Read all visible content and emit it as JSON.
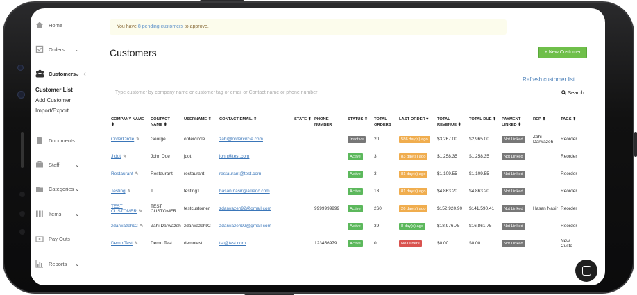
{
  "sidebar": {
    "items": [
      {
        "label": "Home",
        "icon": "home-icon"
      },
      {
        "label": "Orders",
        "icon": "orders-icon"
      },
      {
        "label": "Customers",
        "icon": "customers-icon"
      },
      {
        "label": "Documents",
        "icon": "documents-icon"
      },
      {
        "label": "Staff",
        "icon": "staff-icon"
      },
      {
        "label": "Categories",
        "icon": "categories-icon"
      },
      {
        "label": "Items",
        "icon": "items-icon"
      },
      {
        "label": "Pay Outs",
        "icon": "payouts-icon"
      },
      {
        "label": "Reports",
        "icon": "reports-icon"
      }
    ],
    "sub": [
      "Customer List",
      "Add Customer",
      "Import/Export"
    ]
  },
  "alert": {
    "prefix": "You have ",
    "link": "8 pending customers",
    "suffix": " to approve."
  },
  "page": {
    "title": "Customers",
    "new_button": "+ New Customer",
    "refresh": "Refresh customer list"
  },
  "search": {
    "placeholder": "Type customer by company name or customer tag or email or Contact name or phone number",
    "button": "Search"
  },
  "table": {
    "headers": [
      "COMPANY NAME",
      "CONTACT NAME",
      "USERNAME",
      "CONTACT EMAIL",
      "STATE",
      "PHONE NUMBER",
      "STATUS",
      "TOTAL ORDERS",
      "LAST ORDER",
      "TOTAL REVENUE",
      "TOTAL DUE",
      "PAYMENT LINKED",
      "REP",
      "TAGS"
    ],
    "rows": [
      {
        "company": "OrderCircle",
        "contact": "George",
        "username": "ordercircle",
        "email": "zahi@ordercircle.com",
        "state": "",
        "phone": "",
        "status": "Inactive",
        "orders": "20",
        "last_order": "586 day(s) ago",
        "revenue": "$3,267.00",
        "due": "$2,965.00",
        "payment": "Not Linked",
        "rep": "Zahi Darwazeh",
        "tags": "Reorder"
      },
      {
        "company": "J dot",
        "contact": "John Doe",
        "username": "jdot",
        "email": "john@test.com",
        "state": "",
        "phone": "",
        "status": "Active",
        "orders": "3",
        "last_order": "83 day(s) ago",
        "revenue": "$1,258.35",
        "due": "$1,258.35",
        "payment": "Not Linked",
        "rep": "",
        "tags": "Reorder"
      },
      {
        "company": "Restaurant",
        "contact": "Restaurant",
        "username": "restaurant",
        "email": "restaurant@test.com",
        "state": "",
        "phone": "",
        "status": "Active",
        "orders": "3",
        "last_order": "81 day(s) ago",
        "revenue": "$1,109.55",
        "due": "$1,109.55",
        "payment": "Not Linked",
        "rep": "",
        "tags": "Reorder"
      },
      {
        "company": "Testing",
        "contact": "T",
        "username": "testing1",
        "email": "hasan.nasir@alliedc.com",
        "state": "",
        "phone": "",
        "status": "Active",
        "orders": "13",
        "last_order": "81 day(s) ago",
        "revenue": "$4,863.20",
        "due": "$4,863.20",
        "payment": "Not Linked",
        "rep": "",
        "tags": "Reorder"
      },
      {
        "company": "TEST CUSTOMER",
        "contact": "TEST CUSTOMER",
        "username": "testcustomer",
        "email": "zdarwazeh92@gmail.com",
        "state": "",
        "phone": "9999999999",
        "status": "Active",
        "orders": "260",
        "last_order": "26 day(s) ago",
        "revenue": "$152,920.90",
        "due": "$141,590.41",
        "payment": "Not Linked",
        "rep": "Hasan Nasir",
        "tags": "Reorder"
      },
      {
        "company": "zdarwazeh92",
        "contact": "Zahi Darwazeh",
        "username": "zdarwazeh92",
        "email": "zdarwazeh92@gmail.com",
        "state": "",
        "phone": "",
        "status": "Active",
        "orders": "39",
        "last_order": "8 day(s) ago",
        "revenue": "$18,976.75",
        "due": "$16,861.75",
        "payment": "Not Linked",
        "rep": "",
        "tags": "Reorder"
      },
      {
        "company": "Demo Test",
        "contact": "Demo Test",
        "username": "demotest",
        "email": "tst@test.com",
        "state": "",
        "phone": "123456979",
        "status": "Active",
        "orders": "0",
        "last_order": "No Orders",
        "revenue": "$0.00",
        "due": "$0.00",
        "payment": "Not Linked",
        "rep": "",
        "tags": "New Custo"
      }
    ]
  },
  "colors": {
    "accent": "#6fbf4a",
    "link": "#3a76b9",
    "warning": "#f0ad4e",
    "danger": "#d9534f"
  }
}
